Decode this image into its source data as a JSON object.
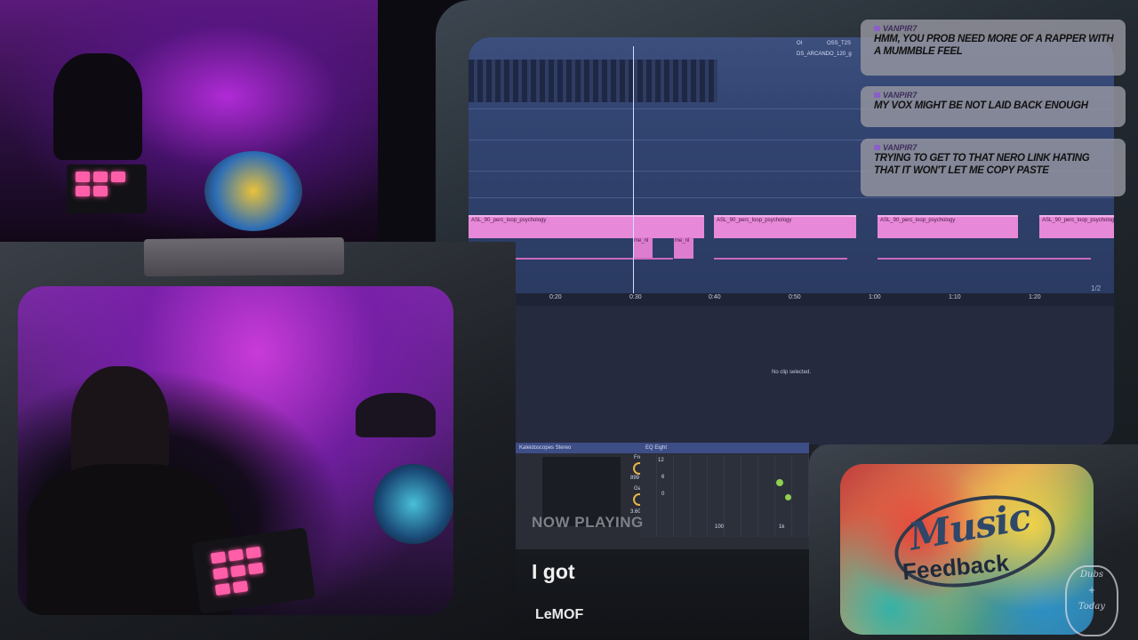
{
  "daw": {
    "top_labels": [
      "OI",
      "OSS_T2S",
      "DS_ARCANDO_120_g"
    ],
    "clip_name": "ASL_90_perc_loop_psychology",
    "small_clip_name": "me_nl",
    "ruler_ticks": [
      "0:20",
      "0:30",
      "0:40",
      "0:50",
      "1:00",
      "1:10",
      "1:20"
    ],
    "page_indicator": "1/2",
    "no_clip": "No clip selected.",
    "device": {
      "name": "Kaleidoscopes Stereo",
      "eq_name": "EQ Eight",
      "freq_label": "Freq",
      "freq_value": "899 Hz",
      "gain_label": "Gain",
      "gain_value": "3.60 dB",
      "grid_top": "12",
      "grid_mid": "6",
      "grid_zero": "0",
      "grid_100": "100",
      "grid_1k": "1k"
    }
  },
  "chat": [
    {
      "user": "VANPIR7",
      "message": "HMM, YOU PROB NEED MORE OF A RAPPER WITH A MUMMBLE FEEL"
    },
    {
      "user": "VANPIR7",
      "message": "MY VOX MIGHT BE NOT LAID BACK ENOUGH"
    },
    {
      "user": "VANPIR7",
      "message": "TRYING TO GET TO THAT NERO LINK HATING THAT IT WON'T LET ME COPY PASTE"
    }
  ],
  "now_playing": {
    "label": "NOW PLAYING",
    "title": "I got",
    "artist": "LeMOF"
  },
  "music_feedback": {
    "word1": "Music",
    "word2": "Feedback"
  },
  "logo": {
    "line1": "Dubs",
    "line2": "+",
    "line3": "Today"
  },
  "colors": {
    "chat_bg": "#9a9aa2",
    "clip_pink": "#e789d8",
    "daw_blue": "#324471"
  }
}
